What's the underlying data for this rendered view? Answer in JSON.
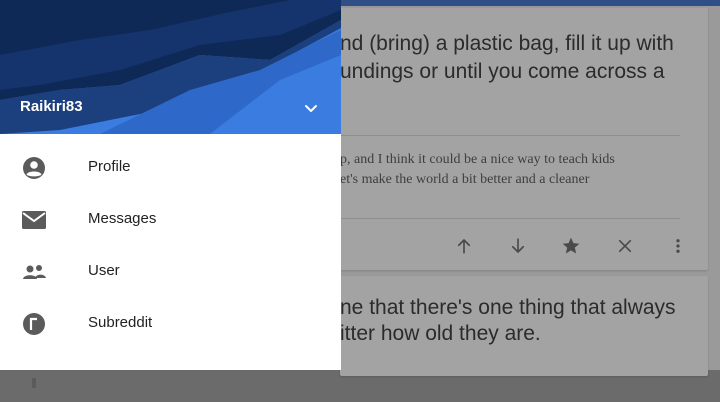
{
  "drawer": {
    "username": "Raikiri83",
    "menu": [
      {
        "label": "Profile",
        "icon": "account-circle-icon"
      },
      {
        "label": "Messages",
        "icon": "mail-icon"
      },
      {
        "label": "User",
        "icon": "people-icon"
      },
      {
        "label": "Subreddit",
        "icon": "subreddit-icon"
      }
    ]
  },
  "background_post": {
    "title_lines": [
      "nd (bring) a plastic bag, fill it up with",
      "undings or until you come across a"
    ],
    "body_lines": [
      "p, and I think it could be a nice way to teach kids",
      "et's make the world a bit better and a cleaner"
    ],
    "actions": [
      "upvote-icon",
      "downvote-icon",
      "star-icon",
      "hide-icon",
      "more-icon"
    ]
  },
  "background_post2": {
    "title_lines": [
      "ne that there's one thing that always",
      "itter how old they are."
    ]
  },
  "colors": {
    "header_blue": "#3a7ce0",
    "header_dark": "#0f2957",
    "scrim_content": "#9a9a9a"
  }
}
